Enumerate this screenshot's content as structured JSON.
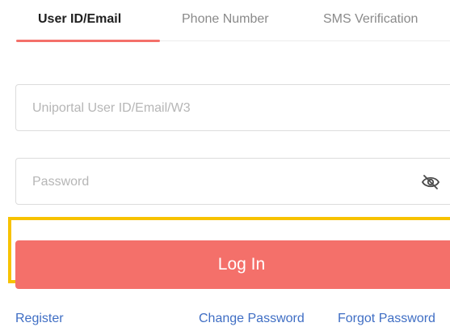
{
  "tabs": [
    {
      "label": "User ID/Email",
      "active": true
    },
    {
      "label": "Phone Number",
      "active": false
    },
    {
      "label": "SMS Verification",
      "active": false
    }
  ],
  "form": {
    "userid_placeholder": "Uniportal User ID/Email/W3",
    "password_placeholder": "Password",
    "login_label": "Log In"
  },
  "links": {
    "register": "Register",
    "change_password": "Change Password",
    "forgot_password": "Forgot Password"
  },
  "colors": {
    "accent": "#f4706a",
    "highlight": "#f7c200",
    "link": "#3f6ec4"
  },
  "icons": {
    "password_toggle": "eye-slash-icon"
  }
}
